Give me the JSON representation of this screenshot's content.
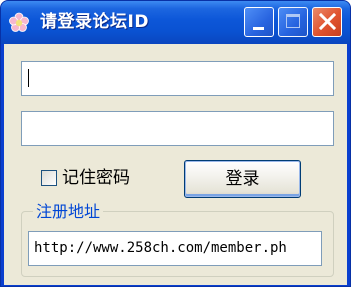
{
  "window": {
    "title": "请登录论坛ID",
    "app_icon": "flower-icon",
    "minimize_icon": "minimize-icon",
    "maximize_icon": "maximize-icon",
    "close_icon": "close-icon"
  },
  "form": {
    "username_value": "",
    "password_value": "",
    "remember_label": "记住密码",
    "remember_checked": false,
    "login_label": "登录"
  },
  "register": {
    "group_title": "注册地址",
    "url": "http://www.258ch.com/member.ph"
  },
  "colors": {
    "titlebar": "#0a52d2",
    "client_bg": "#ece9d8",
    "group_title": "#0046d5",
    "close_button": "#e0532f"
  }
}
